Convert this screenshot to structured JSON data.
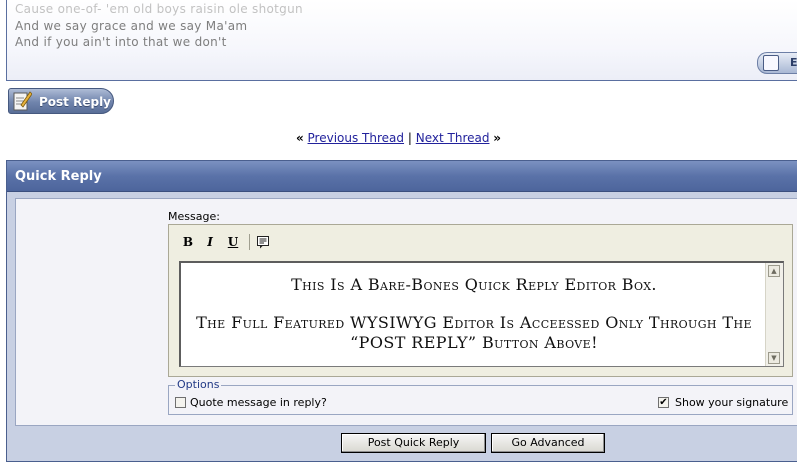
{
  "previous_post": {
    "lines": [
      "Cause one-of- 'em old boys raisin ole shotgun",
      "And we say grace and we say Ma'am",
      "And if you ain't into that we don't"
    ],
    "edit_button_label": "E"
  },
  "post_reply_button": {
    "label": "Post Reply"
  },
  "thread_nav": {
    "left_quote": "«",
    "previous_label": "Previous Thread",
    "separator": "|",
    "next_label": "Next Thread",
    "right_quote": "»"
  },
  "quick_reply": {
    "title": "Quick Reply",
    "message_label": "Message:",
    "toolbar": {
      "bold": "B",
      "italic": "I",
      "underline": "U",
      "quote_icon": "quote-icon"
    },
    "editor_text": {
      "line1": "This Is A Bare-Bones Quick Reply Editor Box.",
      "line2": "The Full Featured WYSIWYG Editor Is Acceessed Only Through The “POST REPLY” Button Above!"
    },
    "options": {
      "legend": "Options",
      "quote_label": "Quote message in reply?",
      "quote_checked": false,
      "signature_label": "Show your signature",
      "signature_checked": true
    },
    "buttons": {
      "post_quick_reply": "Post Quick Reply",
      "go_advanced": "Go Advanced"
    }
  },
  "colors": {
    "header_blue": "#5a72a8",
    "panel_bg": "#c8d0e3",
    "link_blue": "#22229c"
  }
}
